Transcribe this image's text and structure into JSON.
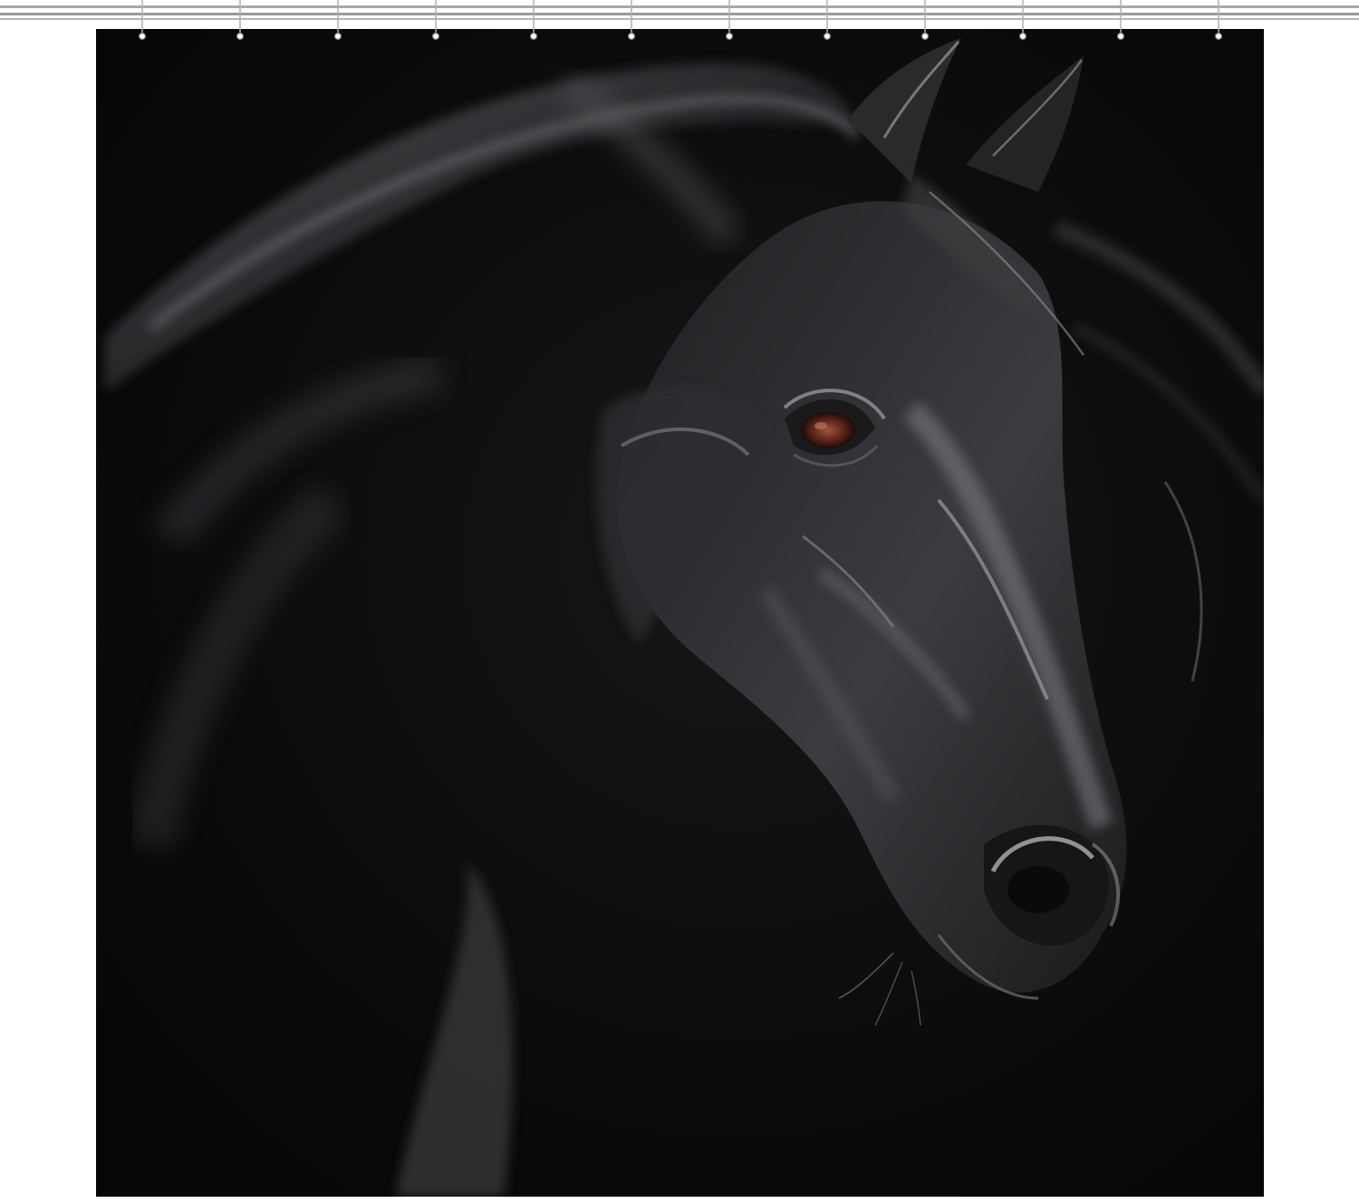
{
  "image": {
    "subject": "black-horse-head-shower-curtain",
    "colors": {
      "background": "#0b0b0c",
      "highlight": "#8e8e92",
      "mid_tone": "#3a3a3e",
      "eye": "#7a3a2a",
      "rod": "#9a9a9a"
    }
  }
}
